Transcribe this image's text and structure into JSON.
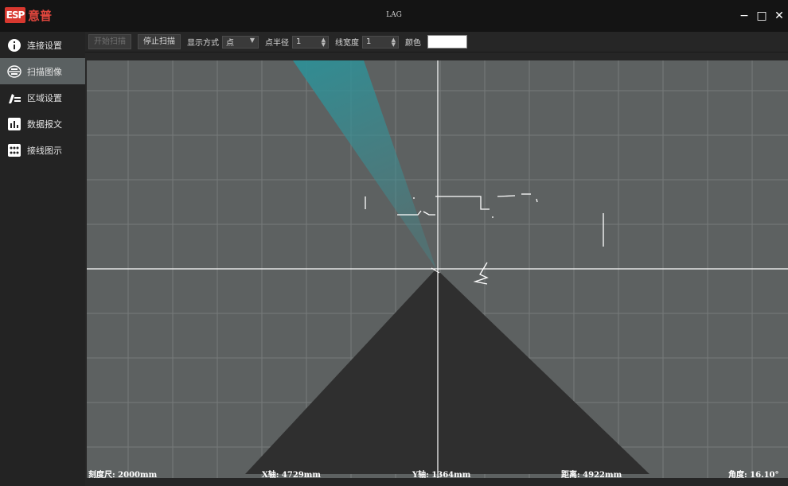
{
  "app": {
    "logo_mark": "ESP",
    "logo_text": "意普",
    "window_title": "LAG",
    "controls": {
      "minimize": "−",
      "maximize": "□",
      "close": "✕"
    }
  },
  "sidebar": {
    "items": [
      {
        "label": "连接设置",
        "icon": "info-icon"
      },
      {
        "label": "扫描图像",
        "icon": "scan-icon"
      },
      {
        "label": "区域设置",
        "icon": "region-edit-icon"
      },
      {
        "label": "数据报文",
        "icon": "bar-chart-icon"
      },
      {
        "label": "接线图示",
        "icon": "wiring-icon"
      }
    ],
    "active_index": 1
  },
  "toolbar": {
    "start_scan": "开始扫描",
    "stop_scan": "停止扫描",
    "display_mode_label": "显示方式",
    "display_mode_value": "点",
    "point_radius_label": "点半径",
    "point_radius_value": "1",
    "line_width_label": "线宽度",
    "line_width_value": "1",
    "color_label": "颜色",
    "color_value": "#ffffff"
  },
  "readouts": {
    "scale": "刻度尺: 2000mm",
    "x_axis": "X轴: 4729mm",
    "y_axis": "Y轴: 1364mm",
    "distance": "距离: 4922mm",
    "angle": "角度: 16.10°"
  },
  "colors": {
    "grid_bg": "#5d6161",
    "grid_line": "#777b7b",
    "blind_zone": "#2f2f2f",
    "beam": "#2e8f96",
    "axis": "#ffffff"
  }
}
